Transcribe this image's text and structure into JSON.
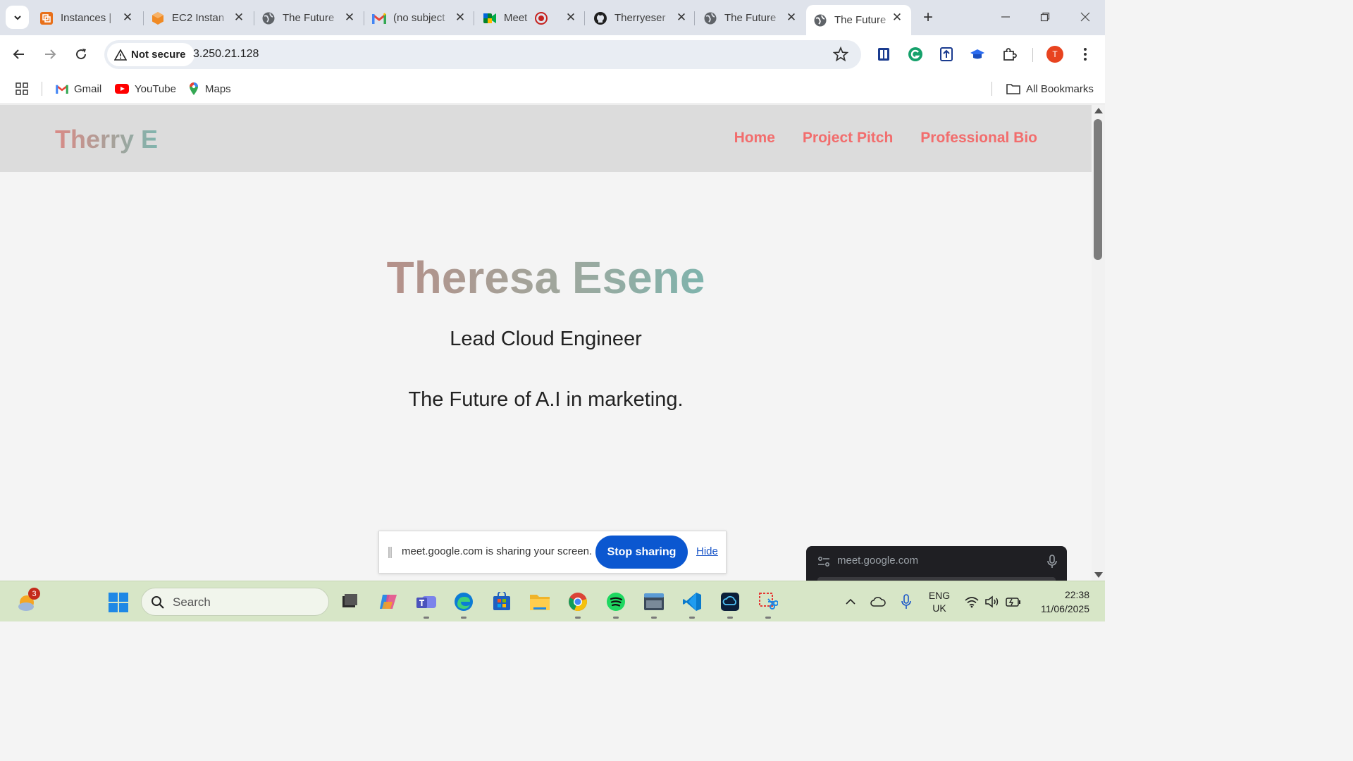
{
  "browser": {
    "tabs": [
      {
        "title": "Instances |",
        "icon": "aws-console-icon"
      },
      {
        "title": "EC2 Instan",
        "icon": "ec2-icon"
      },
      {
        "title": "The Future",
        "icon": "globe-icon"
      },
      {
        "title": "(no subject",
        "icon": "gmail-icon"
      },
      {
        "title": "Meet -",
        "icon": "meet-icon"
      },
      {
        "title": "Therryeser",
        "icon": "github-icon"
      },
      {
        "title": "The Future",
        "icon": "globe-icon"
      },
      {
        "title": "The Future",
        "icon": "globe-icon",
        "active": true
      }
    ],
    "security_label": "Not secure",
    "url": "3.250.21.128",
    "profile_initial": "T",
    "bookmarks": [
      {
        "label": "Gmail",
        "icon": "gmail-icon"
      },
      {
        "label": "YouTube",
        "icon": "youtube-icon"
      },
      {
        "label": "Maps",
        "icon": "maps-icon"
      }
    ],
    "all_bookmarks_label": "All Bookmarks"
  },
  "site": {
    "logo": "Therry E",
    "nav": [
      "Home",
      "Project Pitch",
      "Professional Bio"
    ],
    "hero_name": "Theresa Esene",
    "hero_role": "Lead Cloud Engineer",
    "hero_tagline": "The Future of A.I in marketing."
  },
  "share_bar": {
    "message": "meet.google.com is sharing your screen.",
    "stop_label": "Stop sharing",
    "hide_label": "Hide"
  },
  "meet_pip": {
    "url": "meet.google.com"
  },
  "taskbar": {
    "weather_badge": "3",
    "search_placeholder": "Search",
    "lang_line1": "ENG",
    "lang_line2": "UK",
    "time": "22:38",
    "date": "11/06/2025"
  },
  "colors": {
    "nav_link": "#f26d6d",
    "stop_button": "#0b57d0",
    "taskbar_bg": "#d7e6c7"
  }
}
